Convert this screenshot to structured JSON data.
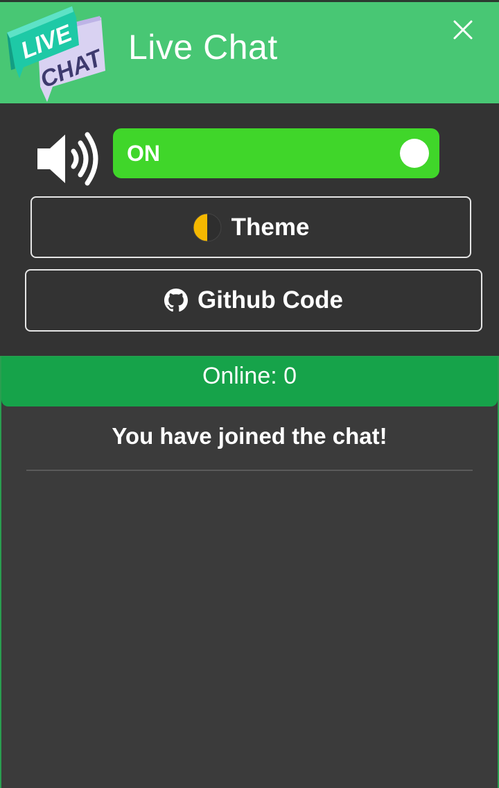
{
  "header": {
    "title": "Live Chat",
    "logo_text_top": "LIVE",
    "logo_text_bottom": "CHAT",
    "close_icon": "close-icon",
    "bg_color": "#48c774"
  },
  "controls": {
    "sound_icon": "speaker-volume-icon",
    "toggle": {
      "label": "ON",
      "state": "on",
      "color": "#40d62a"
    },
    "theme_button": {
      "label": "Theme",
      "icon": "half-moon-icon"
    },
    "github_button": {
      "label": "Github Code",
      "icon": "github-icon"
    }
  },
  "chat": {
    "online_text": "Online: 0",
    "online_bar_color": "#16a34a",
    "system_message": "You have joined the chat!"
  }
}
